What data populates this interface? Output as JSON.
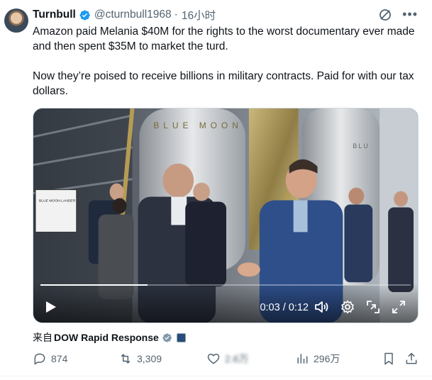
{
  "author": {
    "display_name": "Turnbull",
    "handle": "@cturnbull1968",
    "time": "16小时",
    "separator": "·"
  },
  "tweet": {
    "paragraph1": "Amazon paid Melania $40M for the rights to the worst  documentary ever made and then spent $35M to market the turd.",
    "paragraph2": "Now they’re poised to receive billions in military contracts. Paid for with our tax dollars."
  },
  "video": {
    "scene_text_left": "BLUE MOON",
    "scene_text_right": "BLU",
    "sign_text": "BLUE MOON LANDER",
    "current_time": "0:03",
    "duration": "0:12",
    "time_sep": " / ",
    "progress": 0.29
  },
  "source": {
    "label": "来自",
    "name": "DOW Rapid Response"
  },
  "actions": {
    "replies": "874",
    "retweets": "3,309",
    "likes": "2.6万",
    "views": "296万"
  },
  "colors": {
    "verified_blue": "#1d9bf0",
    "muted": "#536471",
    "gov_badge": "#829aab"
  }
}
